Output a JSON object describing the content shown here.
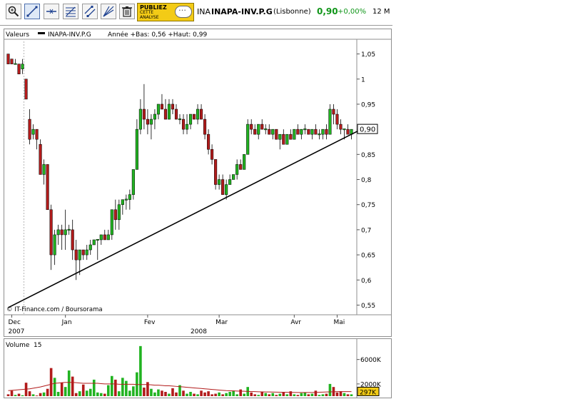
{
  "toolbar": {
    "tools": [
      {
        "name": "zoom-tool",
        "icon": "magnifier-plus-icon"
      },
      {
        "name": "trendline-tool",
        "icon": "diagonal-line-icon"
      },
      {
        "name": "horizontal-line-tool",
        "icon": "horizontal-line-icon"
      },
      {
        "name": "fibonacci-tool",
        "icon": "retracement-icon"
      },
      {
        "name": "channel-tool",
        "icon": "parallel-lines-icon"
      },
      {
        "name": "fan-tool",
        "icon": "fan-lines-icon"
      },
      {
        "name": "delete-tool",
        "icon": "trash-icon"
      }
    ],
    "promo": {
      "line1": "PUBLIEZ",
      "line2": "CETTE ANALYSE",
      "icon": "speech-bubble-icon"
    }
  },
  "ticker": {
    "short": "INA",
    "name": "INAPA-INV.P.G",
    "exchange": "(Lisbonne)",
    "price": "0,90",
    "change": "+0,00%",
    "period": "12 M",
    "price_color": "#11961a"
  },
  "chart_data": {
    "type": "candlestick",
    "legend": {
      "label": "Valeurs",
      "series": "INAPA-INV.P.G",
      "info": "Année +Bas: 0,56 +Haut: 0,99"
    },
    "y_ticks": [
      "1,05",
      "1",
      "0,95",
      "0,9",
      "0,85",
      "0,8",
      "0,75",
      "0,7",
      "0,65",
      "0,6",
      "0,55"
    ],
    "ylim": [
      0.535,
      1.075
    ],
    "current_price_label": "0,90",
    "x_month_labels": [
      {
        "label": "Dec",
        "pos": 1
      },
      {
        "label": "Jan",
        "pos": 16
      },
      {
        "label": "Fev",
        "pos": 39
      },
      {
        "label": "Mar",
        "pos": 59
      },
      {
        "label": "Avr",
        "pos": 80
      },
      {
        "label": "Mai",
        "pos": 92
      }
    ],
    "x_year_labels": [
      {
        "label": "2007",
        "pos": 1
      },
      {
        "label": "2008",
        "pos": 52
      }
    ],
    "watermark": "© IT-Finance.com / Boursorama",
    "up_color": "#21b321",
    "down_color": "#b21b1b",
    "trendline": {
      "from": [
        1,
        0.545
      ],
      "to": [
        97,
        0.898
      ]
    },
    "candles": [
      [
        1.05,
        1.05,
        1.04,
        1.03
      ],
      [
        1.04,
        1.04,
        1.03,
        1.03
      ],
      [
        1.03,
        1.04,
        1.03,
        1.03
      ],
      [
        1.03,
        1.03,
        1.02,
        1.01
      ],
      [
        1.02,
        1.04,
        1.01,
        1.03
      ],
      [
        1.0,
        1.0,
        0.96,
        0.96
      ],
      [
        0.92,
        0.94,
        0.87,
        0.88
      ],
      [
        0.89,
        0.91,
        0.88,
        0.9
      ],
      [
        0.9,
        0.9,
        0.86,
        0.88
      ],
      [
        0.87,
        0.88,
        0.82,
        0.81
      ],
      [
        0.81,
        0.84,
        0.79,
        0.83
      ],
      [
        0.83,
        0.83,
        0.75,
        0.74
      ],
      [
        0.74,
        0.75,
        0.62,
        0.65
      ],
      [
        0.65,
        0.7,
        0.63,
        0.69
      ],
      [
        0.69,
        0.71,
        0.67,
        0.7
      ],
      [
        0.7,
        0.71,
        0.66,
        0.69
      ],
      [
        0.69,
        0.74,
        0.66,
        0.7
      ],
      [
        0.7,
        0.71,
        0.69,
        0.7
      ],
      [
        0.7,
        0.72,
        0.64,
        0.66
      ],
      [
        0.66,
        0.68,
        0.6,
        0.64
      ],
      [
        0.64,
        0.66,
        0.61,
        0.66
      ],
      [
        0.66,
        0.66,
        0.64,
        0.65
      ],
      [
        0.65,
        0.67,
        0.64,
        0.66
      ],
      [
        0.66,
        0.68,
        0.65,
        0.67
      ],
      [
        0.67,
        0.68,
        0.67,
        0.68
      ],
      [
        0.68,
        0.68,
        0.64,
        0.68
      ],
      [
        0.68,
        0.68,
        0.67,
        0.69
      ],
      [
        0.69,
        0.7,
        0.68,
        0.68
      ],
      [
        0.68,
        0.7,
        0.68,
        0.69
      ],
      [
        0.69,
        0.74,
        0.68,
        0.74
      ],
      [
        0.74,
        0.76,
        0.7,
        0.72
      ],
      [
        0.72,
        0.76,
        0.7,
        0.75
      ],
      [
        0.75,
        0.76,
        0.73,
        0.76
      ],
      [
        0.76,
        0.77,
        0.74,
        0.76
      ],
      [
        0.76,
        0.78,
        0.74,
        0.77
      ],
      [
        0.77,
        0.82,
        0.76,
        0.82
      ],
      [
        0.82,
        0.92,
        0.82,
        0.9
      ],
      [
        0.9,
        0.96,
        0.89,
        0.94
      ],
      [
        0.94,
        0.99,
        0.9,
        0.92
      ],
      [
        0.92,
        0.94,
        0.89,
        0.91
      ],
      [
        0.91,
        0.93,
        0.88,
        0.92
      ],
      [
        0.92,
        0.94,
        0.9,
        0.93
      ],
      [
        0.93,
        0.95,
        0.92,
        0.95
      ],
      [
        0.95,
        0.97,
        0.94,
        0.94
      ],
      [
        0.94,
        0.96,
        0.92,
        0.92
      ],
      [
        0.92,
        0.96,
        0.92,
        0.95
      ],
      [
        0.95,
        0.96,
        0.93,
        0.94
      ],
      [
        0.94,
        0.95,
        0.92,
        0.92
      ],
      [
        0.92,
        0.93,
        0.91,
        0.92
      ],
      [
        0.92,
        0.93,
        0.89,
        0.9
      ],
      [
        0.9,
        0.93,
        0.89,
        0.91
      ],
      [
        0.91,
        0.93,
        0.9,
        0.93
      ],
      [
        0.93,
        0.93,
        0.92,
        0.92
      ],
      [
        0.92,
        0.95,
        0.91,
        0.94
      ],
      [
        0.94,
        0.95,
        0.93,
        0.92
      ],
      [
        0.92,
        0.93,
        0.88,
        0.89
      ],
      [
        0.89,
        0.9,
        0.85,
        0.86
      ],
      [
        0.86,
        0.87,
        0.83,
        0.84
      ],
      [
        0.84,
        0.84,
        0.78,
        0.79
      ],
      [
        0.79,
        0.81,
        0.78,
        0.8
      ],
      [
        0.8,
        0.81,
        0.77,
        0.77
      ],
      [
        0.77,
        0.8,
        0.76,
        0.79
      ],
      [
        0.79,
        0.81,
        0.79,
        0.8
      ],
      [
        0.8,
        0.81,
        0.8,
        0.81
      ],
      [
        0.81,
        0.84,
        0.8,
        0.83
      ],
      [
        0.83,
        0.84,
        0.82,
        0.82
      ],
      [
        0.82,
        0.85,
        0.82,
        0.85
      ],
      [
        0.85,
        0.92,
        0.85,
        0.91
      ],
      [
        0.91,
        0.92,
        0.89,
        0.9
      ],
      [
        0.9,
        0.91,
        0.89,
        0.89
      ],
      [
        0.89,
        0.91,
        0.88,
        0.91
      ],
      [
        0.91,
        0.92,
        0.9,
        0.9
      ],
      [
        0.9,
        0.91,
        0.89,
        0.9
      ],
      [
        0.9,
        0.91,
        0.89,
        0.89
      ],
      [
        0.89,
        0.9,
        0.88,
        0.9
      ],
      [
        0.9,
        0.9,
        0.88,
        0.88
      ],
      [
        0.88,
        0.89,
        0.86,
        0.89
      ],
      [
        0.89,
        0.9,
        0.87,
        0.87
      ],
      [
        0.87,
        0.89,
        0.87,
        0.89
      ],
      [
        0.89,
        0.9,
        0.88,
        0.88
      ],
      [
        0.88,
        0.9,
        0.88,
        0.9
      ],
      [
        0.9,
        0.91,
        0.89,
        0.89
      ],
      [
        0.89,
        0.9,
        0.88,
        0.9
      ],
      [
        0.9,
        0.91,
        0.89,
        0.9
      ],
      [
        0.9,
        0.9,
        0.89,
        0.89
      ],
      [
        0.89,
        0.9,
        0.88,
        0.9
      ],
      [
        0.9,
        0.91,
        0.89,
        0.89
      ],
      [
        0.89,
        0.9,
        0.88,
        0.89
      ],
      [
        0.89,
        0.9,
        0.88,
        0.9
      ],
      [
        0.9,
        0.91,
        0.88,
        0.89
      ],
      [
        0.89,
        0.95,
        0.89,
        0.94
      ],
      [
        0.94,
        0.95,
        0.91,
        0.93
      ],
      [
        0.93,
        0.94,
        0.9,
        0.91
      ],
      [
        0.91,
        0.92,
        0.89,
        0.9
      ],
      [
        0.9,
        0.9,
        0.88,
        0.9
      ],
      [
        0.9,
        0.91,
        0.89,
        0.89
      ],
      [
        0.89,
        0.9,
        0.88,
        0.9
      ]
    ],
    "volume": {
      "label": "Volume",
      "value_label": "15",
      "y_ticks": [
        "6000K",
        "2000K",
        "297K"
      ],
      "ymax": 9000,
      "values": [
        300,
        900,
        200,
        400,
        150,
        2200,
        800,
        300,
        100,
        500,
        600,
        1200,
        4600,
        3000,
        700,
        2200,
        1500,
        4200,
        3200,
        500,
        800,
        1900,
        900,
        1200,
        2700,
        600,
        500,
        400,
        1800,
        3300,
        2700,
        800,
        3000,
        2500,
        900,
        1600,
        3900,
        8200,
        1400,
        2300,
        1200,
        600,
        1100,
        900,
        700,
        400,
        1300,
        600,
        1800,
        900,
        400,
        700,
        400,
        300,
        900,
        600,
        800,
        300,
        400,
        600,
        300,
        500,
        700,
        900,
        300,
        1100,
        400,
        1500,
        600,
        300,
        200,
        700,
        500,
        300,
        500,
        200,
        400,
        600,
        300,
        800,
        300,
        200,
        500,
        600,
        300,
        400,
        900,
        200,
        300,
        400,
        2000,
        1500,
        600,
        800,
        500,
        300,
        297
      ],
      "avg": [
        900,
        950,
        1000,
        1050,
        1100,
        1150,
        1200,
        1300,
        1400,
        1500,
        1650,
        1800,
        1950,
        2100,
        2150,
        2200,
        2250,
        2250,
        2250,
        2200,
        2150,
        2100,
        2100,
        2100,
        2100,
        2100,
        2050,
        2000,
        2000,
        2000,
        2000,
        1950,
        1950,
        1950,
        1950,
        1950,
        1900,
        1900,
        1900,
        1900,
        1850,
        1800,
        1800,
        1750,
        1700,
        1700,
        1650,
        1600,
        1550,
        1500,
        1450,
        1400,
        1350,
        1300,
        1250,
        1200,
        1150,
        1100,
        1050,
        1000,
        950,
        900,
        880,
        860,
        840,
        820,
        800,
        780,
        760,
        740,
        720,
        700,
        690,
        680,
        670,
        660,
        650,
        640,
        630,
        620,
        610,
        600,
        600,
        600,
        600,
        600,
        620,
        640,
        660,
        680,
        700,
        720,
        740,
        740,
        740,
        740,
        740
      ],
      "bar_colors": [
        "#b21b1b",
        "#21b321"
      ]
    }
  }
}
